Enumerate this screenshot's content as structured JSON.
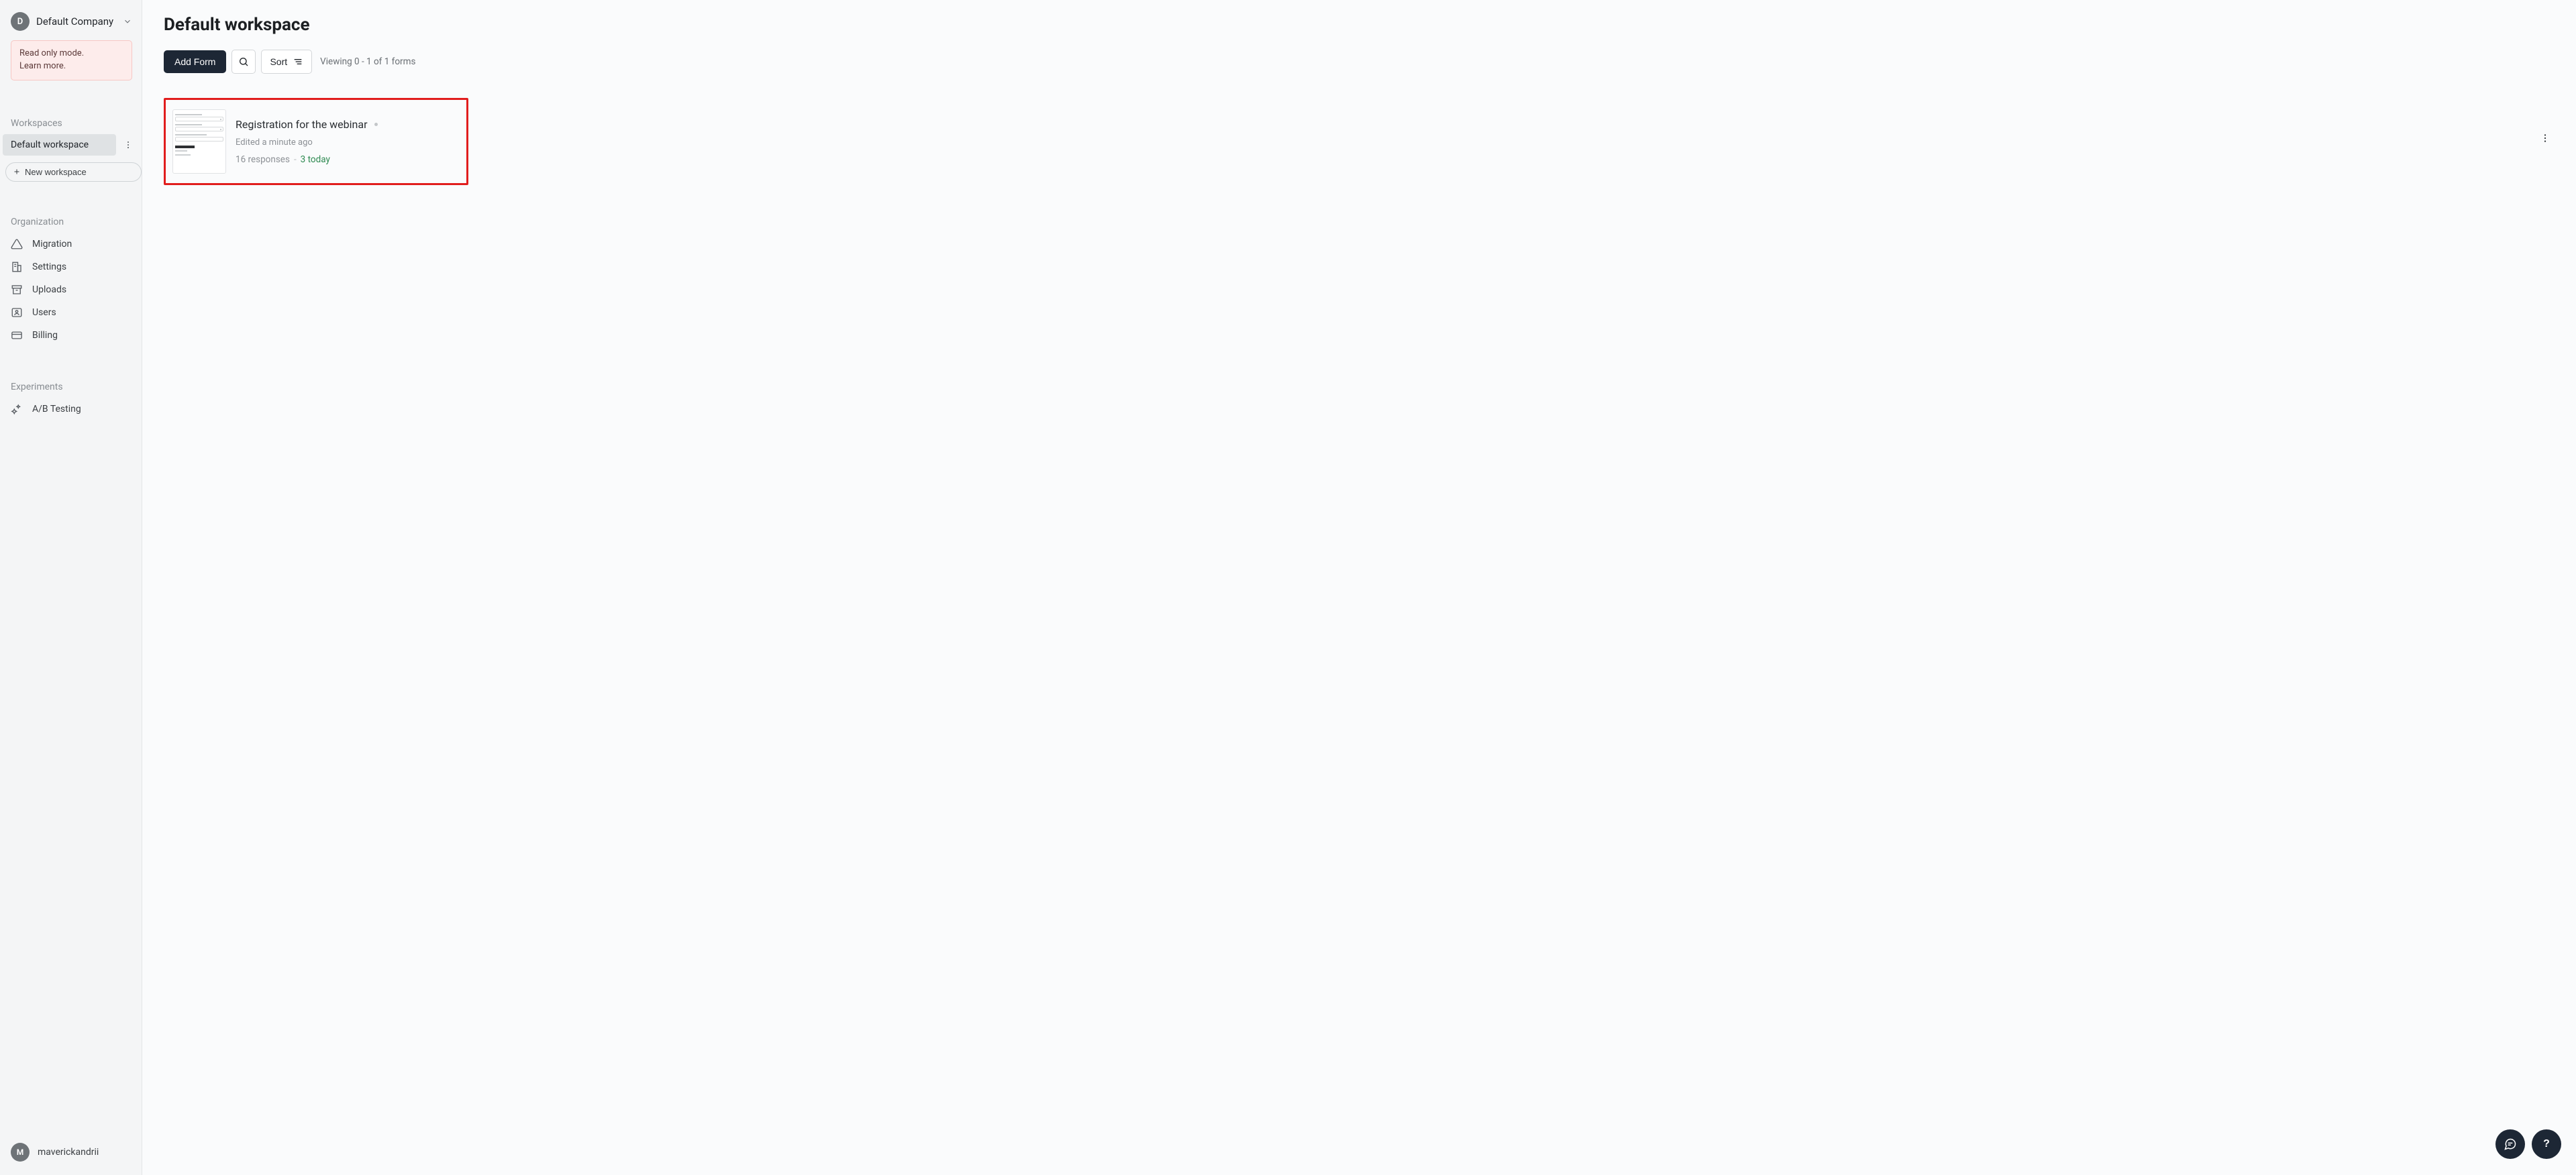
{
  "company": {
    "initial": "D",
    "name": "Default Company"
  },
  "notice": {
    "line1": "Read only mode.",
    "line2": "Learn more."
  },
  "sidebar": {
    "workspaces_label": "Workspaces",
    "active_workspace": "Default workspace",
    "new_workspace": "New workspace",
    "organization_label": "Organization",
    "org_items": {
      "migration": "Migration",
      "settings": "Settings",
      "uploads": "Uploads",
      "users": "Users",
      "billing": "Billing"
    },
    "experiments_label": "Experiments",
    "exp_items": {
      "ab_testing": "A/B Testing"
    }
  },
  "user": {
    "initial": "M",
    "name": "maverickandrii"
  },
  "page": {
    "title": "Default workspace",
    "add_form": "Add Form",
    "sort": "Sort",
    "viewing": "Viewing 0 - 1 of 1 forms"
  },
  "forms": [
    {
      "title": "Registration for the webinar",
      "edited": "Edited a minute ago",
      "responses": "16 responses",
      "today": "3 today"
    }
  ]
}
